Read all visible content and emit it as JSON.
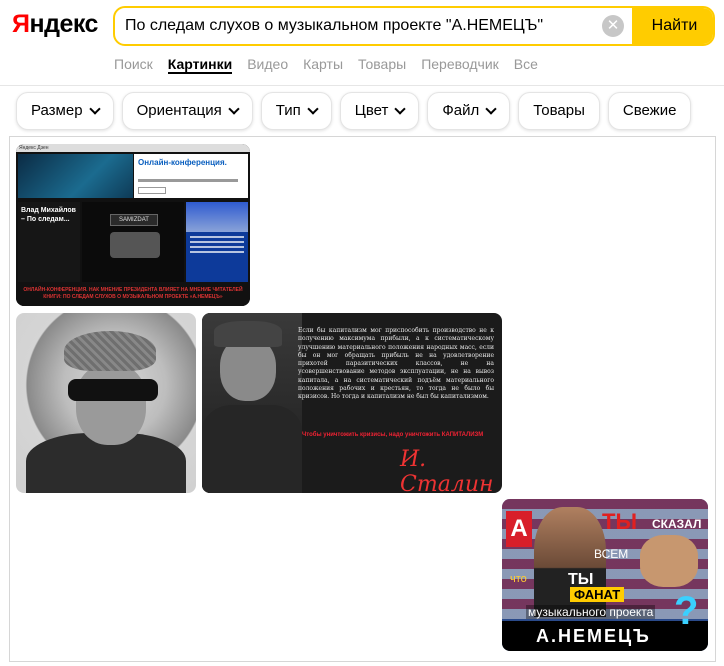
{
  "header": {
    "logo_first": "Я",
    "logo_rest": "ндекс",
    "search": {
      "value": "По следам слухов о музыкальном проекте \"А.НЕМЕЦЪ\"",
      "clear": "✕",
      "button": "Найти"
    },
    "nav": [
      "Поиск",
      "Картинки",
      "Видео",
      "Карты",
      "Товары",
      "Переводчик",
      "Все"
    ],
    "nav_active": "Картинки"
  },
  "filters": [
    "Размер",
    "Ориентация",
    "Тип",
    "Цвет",
    "Файл",
    "Товары",
    "Свежие"
  ],
  "results": {
    "thumb1": {
      "topbar": "Яндекс Дзен",
      "panel_title": "Онлайн-конференция.",
      "left_title": "Влад Михайлов – По следам...",
      "samizdat": "SAMIZDAT",
      "caption": "ОНЛАЙН-КОНФЕРЕНЦИЯ. НАК МНЕНИЕ ПРЕЗИДЕНТА ВЛИЯЕТ НА МНЕНИЕ ЧИТАТЕЛЕЙ КНИГИ: ПО СЛЕДАМ СЛУХОВ О МУЗЫКАЛЬНОМ ПРОЕКТЕ «А.НЕМЕЦЪ»"
    },
    "thumb3": {
      "quote": "Если бы капитализм мог приспособить производство не к получению максимума прибыли, а к систематическому улучшению материального положения народных масс, если бы он мог обращать прибыль не на удовлетворение прихотей паразитических классов, не на усовершенствование методов эксплуатации, не на вывоз капитала, а на систематический подъём материального положения рабочих и крестьян, то тогда не было бы кризисов. Но тогда и капитализм не был бы капитализмом.",
      "quote_red": "Чтобы уничтожить кризисы, надо уничтожить КАПИТАЛИЗМ",
      "signature": "И. Сталин"
    },
    "thumb4": {
      "badge": "А",
      "ty": "ТЫ",
      "skazal": "СКАЗАЛ",
      "vsem": "ВСЕМ",
      "chto": "что",
      "ty2": "ТЫ",
      "fanat": "ФАНАТ",
      "music": "музыкального проекта",
      "name": "А.НЕМЕЦЪ",
      "q": "?"
    }
  }
}
